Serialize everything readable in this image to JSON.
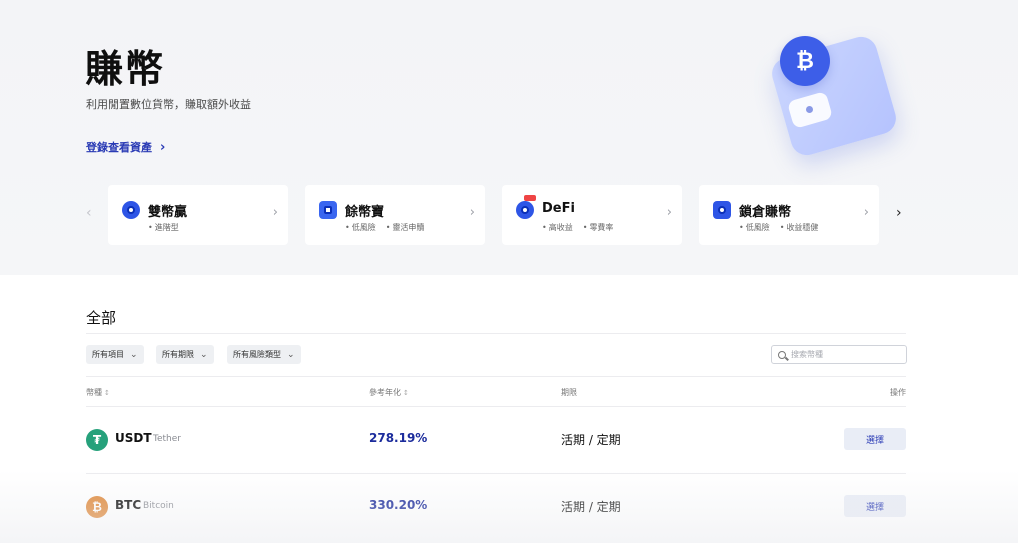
{
  "hero": {
    "title": "賺幣",
    "subtitle": "利用閒置數位貨幣，賺取額外收益",
    "login_link": "登錄查看資產"
  },
  "colors": {
    "brand_blue": "#2a3bb5",
    "apy_text": "#1c2c9c",
    "usdt": "#26a17b",
    "btc": "#e08a3c"
  },
  "categories": [
    {
      "title": "雙幣贏",
      "tags": [
        "進階型"
      ],
      "icon": "dual-coin-icon"
    },
    {
      "title": "餘幣寶",
      "tags": [
        "低風險",
        "靈活申贖"
      ],
      "icon": "savings-box-icon"
    },
    {
      "title": "DeFi",
      "tags": [
        "高收益",
        "零費率"
      ],
      "icon": "defi-icon"
    },
    {
      "title": "鎖倉賺幣",
      "tags": [
        "低風險",
        "收益穩健"
      ],
      "icon": "lock-stake-icon"
    }
  ],
  "section": {
    "title": "全部",
    "filters": [
      "所有項目",
      "所有期限",
      "所有風險類型"
    ],
    "search_placeholder": "搜索幣種"
  },
  "table": {
    "headers": [
      "幣種",
      "參考年化",
      "期限",
      "操作"
    ],
    "rows": [
      {
        "symbol": "USDT",
        "name": "Tether",
        "apy": "278.19%",
        "term": "活期 / 定期",
        "action": "選擇",
        "icon": "tether-icon"
      },
      {
        "symbol": "BTC",
        "name": "Bitcoin",
        "apy": "330.20%",
        "term": "活期 / 定期",
        "action": "選擇",
        "icon": "bitcoin-icon"
      }
    ]
  }
}
